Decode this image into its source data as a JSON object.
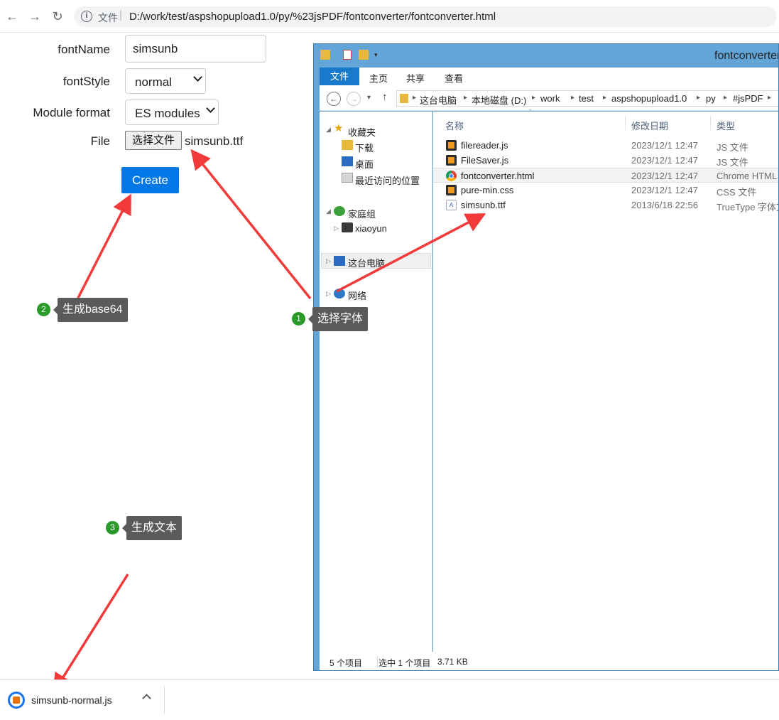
{
  "browser": {
    "scheme_label": "文件",
    "url": "D:/work/test/aspshopupload1.0/py/%23jsPDF/fontconverter/fontconverter.html"
  },
  "form": {
    "font_name_label": "fontName",
    "font_name_value": "simsunb",
    "font_style_label": "fontStyle",
    "font_style_value": "normal",
    "module_format_label": "Module format",
    "module_format_value": "ES modules",
    "file_label": "File",
    "file_button_label": "选择文件",
    "file_chosen": "simsunb.ttf",
    "create_label": "Create"
  },
  "explorer": {
    "title": "fontconverter",
    "ribbon_tabs": [
      "文件",
      "主页",
      "共享",
      "查看"
    ],
    "breadcrumb": [
      "这台电脑",
      "本地磁盘 (D:)",
      "work",
      "test",
      "aspshopupload1.0",
      "py",
      "#jsPDF"
    ],
    "nav": {
      "favorites": "收藏夹",
      "downloads": "下载",
      "desktop": "桌面",
      "recent": "最近访问的位置",
      "homegroup": "家庭组",
      "user": "xiaoyun",
      "this_pc": "这台电脑",
      "network": "网络"
    },
    "columns": {
      "name": "名称",
      "date": "修改日期",
      "type": "类型"
    },
    "files": [
      {
        "name": "filereader.js",
        "date": "2023/12/1 12:47",
        "type": "JS 文件",
        "icon": "sublime-icon"
      },
      {
        "name": "FileSaver.js",
        "date": "2023/12/1 12:47",
        "type": "JS 文件",
        "icon": "sublime-icon"
      },
      {
        "name": "fontconverter.html",
        "date": "2023/12/1 12:47",
        "type": "Chrome HTML",
        "icon": "chrome-icon"
      },
      {
        "name": "pure-min.css",
        "date": "2023/12/1 12:47",
        "type": "CSS 文件",
        "icon": "sublime-icon"
      },
      {
        "name": "simsunb.ttf",
        "date": "2013/6/18 22:56",
        "type": "TrueType 字体文",
        "icon": "font-file-icon"
      }
    ],
    "status": {
      "count": "5 个项目",
      "selected": "选中 1 个项目",
      "size": "3.71 KB"
    }
  },
  "callouts": [
    {
      "num": "1",
      "text": "选择字体"
    },
    {
      "num": "2",
      "text": "生成base64"
    },
    {
      "num": "3",
      "text": "生成文本"
    }
  ],
  "download": {
    "filename": "simsunb-normal.js"
  },
  "colors": {
    "arrow": "#f23a3a",
    "create_button": "#0078e7",
    "badge": "#2a9a2a",
    "ribbon_file": "#1979ca"
  }
}
